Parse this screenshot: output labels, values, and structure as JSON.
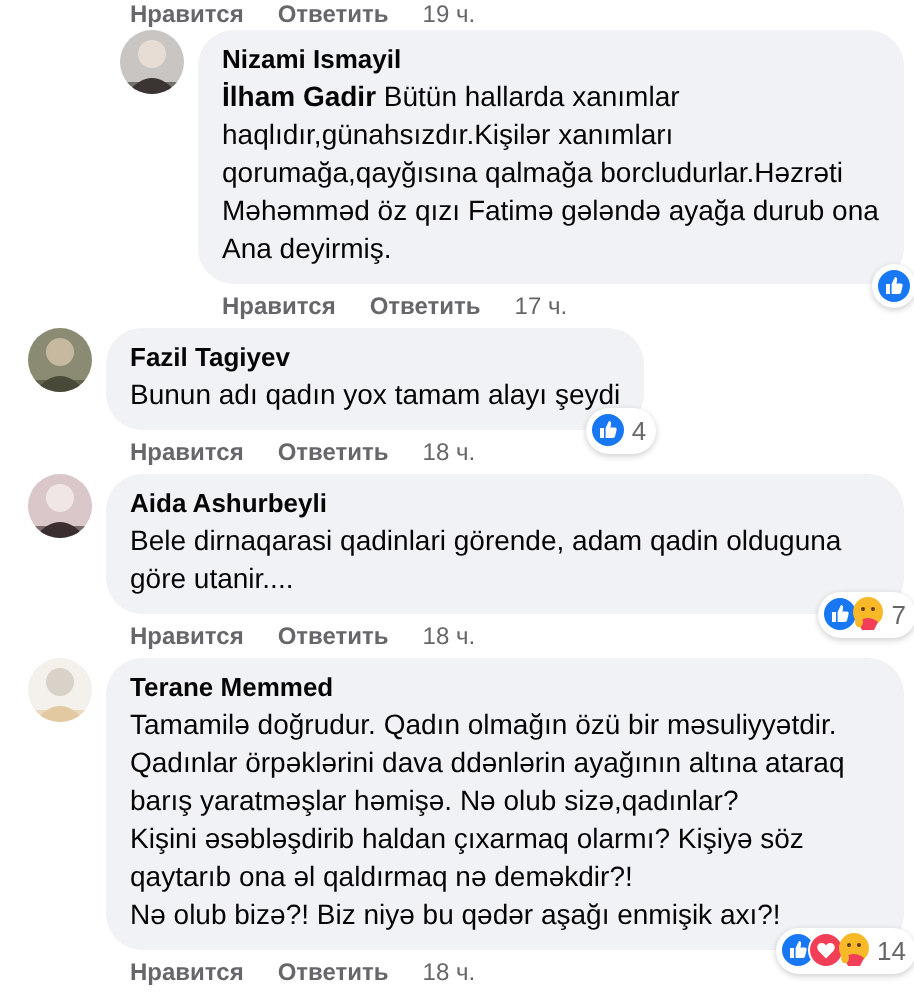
{
  "thread_above": {
    "actions": {
      "like": "Нравится",
      "reply": "Ответить",
      "time": "19 ч."
    },
    "replies": [
      {
        "author": "Nizami Ismayil",
        "text": "**İlham Gadir** Bütün hallarda xanımlar haqlıdır,günahsızdır.Kişilər xanımları qorumağa,qayğısına qalmağa borcludurlar.Həzrəti Məhəmməd öz qızı Fatimə gələndə ayağa durub ona Ana deyirmiş.",
        "reactions": [
          {
            "kind": "like"
          }
        ],
        "actions": {
          "like": "Нравится",
          "reply": "Ответить",
          "time": "17 ч."
        }
      }
    ]
  },
  "comments": [
    {
      "author": "Fazil Tagiyev",
      "text": "Bunun adı qadın yox tamam alayı şeydi",
      "reactions": [
        {
          "kind": "like"
        }
      ],
      "reaction_count": "4",
      "actions": {
        "like": "Нравится",
        "reply": "Ответить",
        "time": "18 ч."
      }
    },
    {
      "author": "Aida Ashurbeyli",
      "text": "Bele dirnaqarasi qadinlari görende, adam qadin olduguna göre utanir....",
      "reactions": [
        {
          "kind": "like"
        },
        {
          "kind": "care"
        }
      ],
      "reaction_count": "7",
      "actions": {
        "like": "Нравится",
        "reply": "Ответить",
        "time": "18 ч."
      }
    },
    {
      "author": "Terane Memmed",
      "text": "Tamamilə doğrudur. Qadın olmağın özü bir məsuliyyətdir. Qadınlar örpəklərini dava ddənlərin ayağının altına ataraq barış yaratməşlar həmişə. Nə olub sizə,qadınlar?\nKişini əsəbləşdirib haldan çıxarmaq olarmı? Kişiyə söz qaytarıb ona əl qaldırmaq nə deməkdir?!\nNə olub bizə?! Biz niyə bu qədər aşağı enmişik axı?!",
      "reactions": [
        {
          "kind": "like"
        },
        {
          "kind": "love"
        },
        {
          "kind": "care"
        }
      ],
      "reaction_count": "14",
      "actions": {
        "like": "Нравится",
        "reply": "Ответить",
        "time": "18 ч."
      }
    }
  ]
}
